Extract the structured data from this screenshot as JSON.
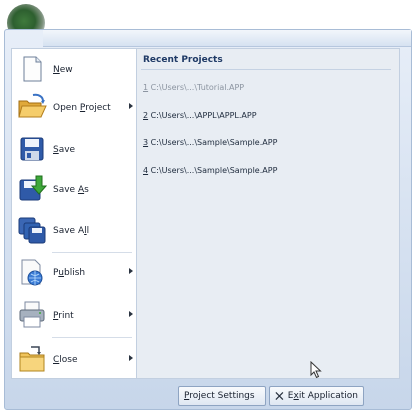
{
  "menu": {
    "commands": [
      {
        "key": "new",
        "pre": "",
        "ul": "N",
        "post": "ew",
        "has_submenu": false
      },
      {
        "key": "open",
        "pre": "Open ",
        "ul": "P",
        "post": "roject",
        "has_submenu": true
      },
      {
        "key": "save",
        "pre": "",
        "ul": "S",
        "post": "ave",
        "has_submenu": false
      },
      {
        "key": "save_as",
        "pre": "Save ",
        "ul": "A",
        "post": "s",
        "has_submenu": false
      },
      {
        "key": "save_all",
        "pre": "Save A",
        "ul": "l",
        "post": "l",
        "has_submenu": false
      },
      {
        "key": "publish",
        "pre": "P",
        "ul": "u",
        "post": "blish",
        "has_submenu": true
      },
      {
        "key": "print",
        "pre": "",
        "ul": "P",
        "post": "rint",
        "has_submenu": true
      },
      {
        "key": "close",
        "pre": "",
        "ul": "C",
        "post": "lose",
        "has_submenu": true
      }
    ]
  },
  "recent": {
    "title": "Recent Projects",
    "items": [
      {
        "num": "1",
        "path": " C:\\Users\\...\\Tutorial.APP",
        "dim": true
      },
      {
        "num": "2",
        "path": " C:\\Users\\...\\APPL\\APPL.APP",
        "dim": false
      },
      {
        "num": "3",
        "path": " C:\\Users\\...\\Sample\\Sample.APP",
        "dim": false
      },
      {
        "num": "4",
        "path": " C:\\Users\\...\\Sample\\Sample.APP",
        "dim": false
      }
    ]
  },
  "footer": {
    "settings": {
      "ul": "P",
      "post": "roject Settings"
    },
    "exit": {
      "pre": "E",
      "ul": "x",
      "post": "it Application"
    }
  },
  "colors": {
    "accent": "#1f3a66",
    "frame": "#c7d6ea"
  }
}
